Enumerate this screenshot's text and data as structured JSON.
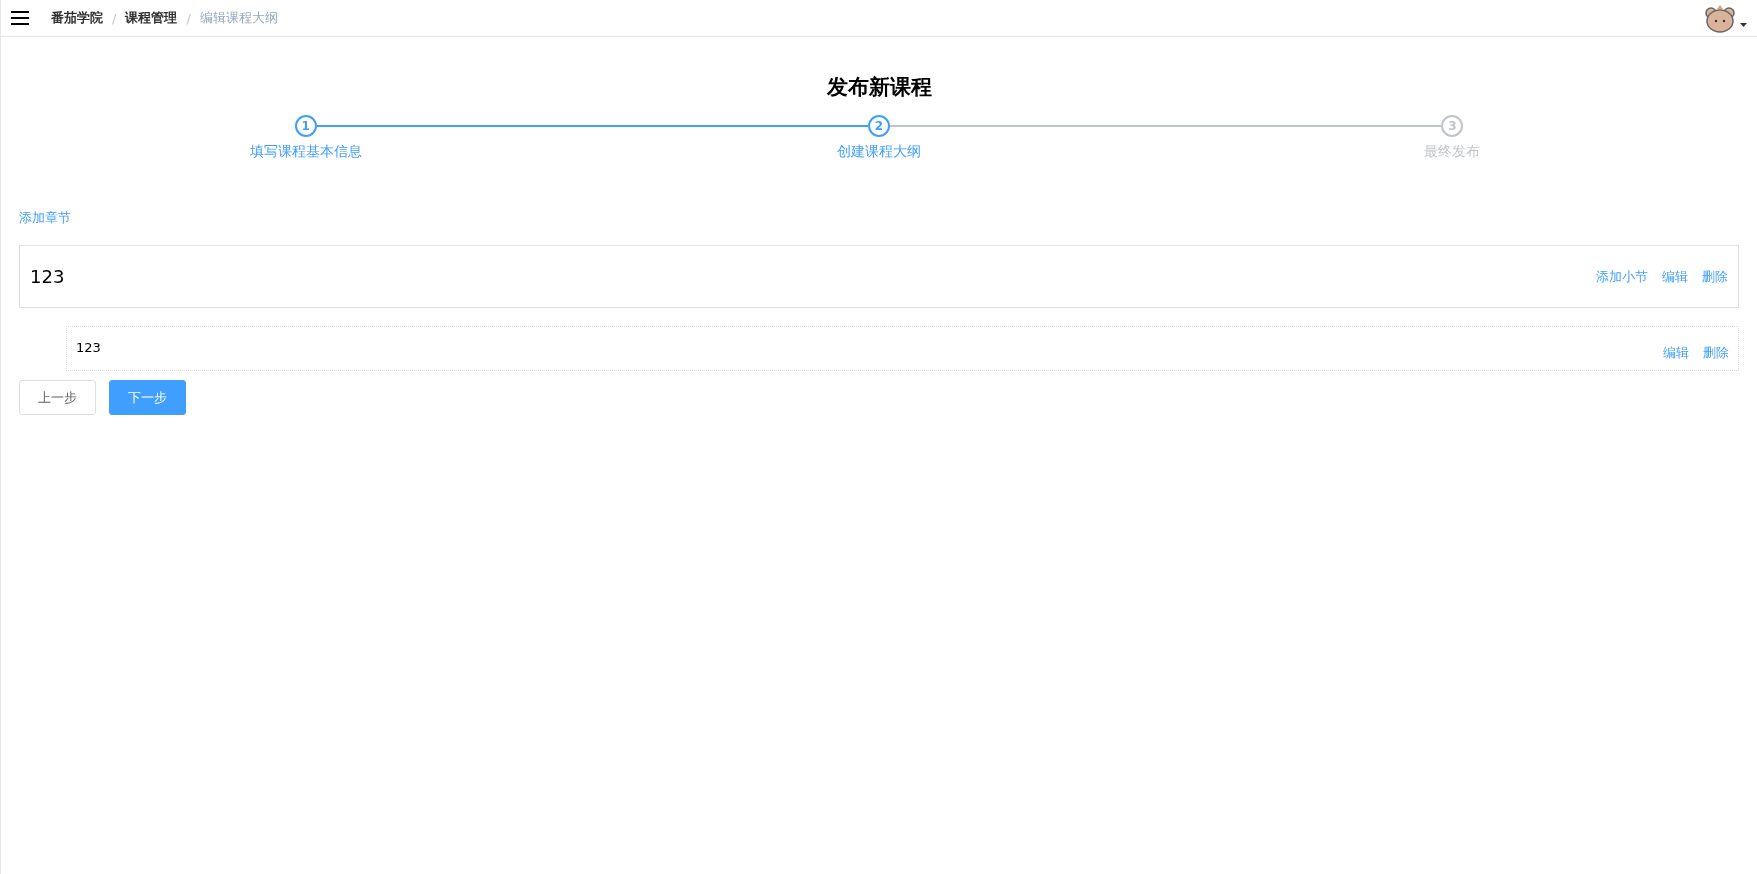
{
  "breadcrumb": [
    {
      "label": "番茄学院",
      "current": false
    },
    {
      "label": "课程管理",
      "current": false
    },
    {
      "label": "编辑课程大纲",
      "current": true
    }
  ],
  "separator": "/",
  "title": "发布新课程",
  "steps": [
    {
      "number": "1",
      "label": "填写课程基本信息",
      "reached": true
    },
    {
      "number": "2",
      "label": "创建课程大纲",
      "reached": true
    },
    {
      "number": "3",
      "label": "最终发布",
      "reached": false
    }
  ],
  "add_chapter": "添加章节",
  "chapters": [
    {
      "title": "123",
      "actions": [
        "添加小节",
        "编辑",
        "删除"
      ],
      "sections": [
        {
          "title": "123",
          "actions": [
            "编辑",
            "删除"
          ]
        }
      ]
    }
  ],
  "buttons": [
    {
      "label": "上一步",
      "kind": "default"
    },
    {
      "label": "下一步",
      "kind": "primary"
    }
  ]
}
